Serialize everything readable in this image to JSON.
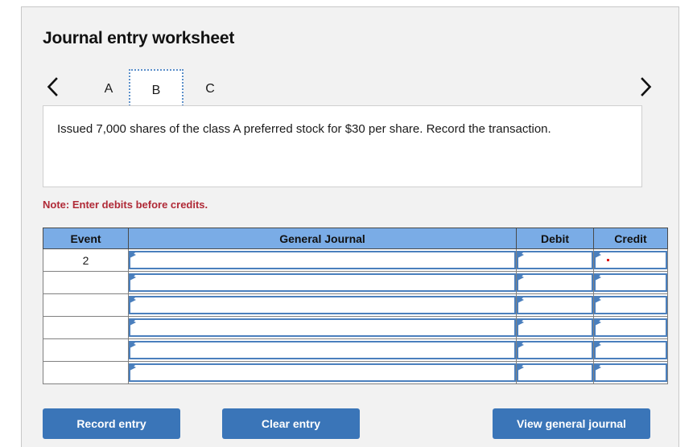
{
  "panel": {
    "title": "Journal entry worksheet"
  },
  "nav": {
    "prev_icon": "chevron-left-icon",
    "next_icon": "chevron-right-icon",
    "tabs": [
      {
        "label": "A",
        "active": false
      },
      {
        "label": "B",
        "active": true
      },
      {
        "label": "C",
        "active": false
      }
    ]
  },
  "description": {
    "text": "Issued 7,000 shares of the class A preferred stock for $30 per share. Record the transaction."
  },
  "note": {
    "text": "Note: Enter debits before credits."
  },
  "journal": {
    "headers": [
      "Event",
      "General Journal",
      "Debit",
      "Credit"
    ],
    "rows": [
      {
        "event": "2",
        "general_journal": "",
        "debit": "",
        "credit": "",
        "credit_marker": "."
      },
      {
        "event": "",
        "general_journal": "",
        "debit": "",
        "credit": ""
      },
      {
        "event": "",
        "general_journal": "",
        "debit": "",
        "credit": ""
      },
      {
        "event": "",
        "general_journal": "",
        "debit": "",
        "credit": ""
      },
      {
        "event": "",
        "general_journal": "",
        "debit": "",
        "credit": ""
      },
      {
        "event": "",
        "general_journal": "",
        "debit": "",
        "credit": ""
      }
    ]
  },
  "buttons": {
    "record": "Record entry",
    "clear": "Clear entry",
    "view": "View general journal"
  },
  "colors": {
    "panel_bg": "#f2f2f2",
    "header_blue": "#7aace6",
    "input_border_blue": "#4a7fbd",
    "button_blue": "#3a75b8",
    "note_red": "#b02a37",
    "marker_red": "#e01b1b"
  }
}
